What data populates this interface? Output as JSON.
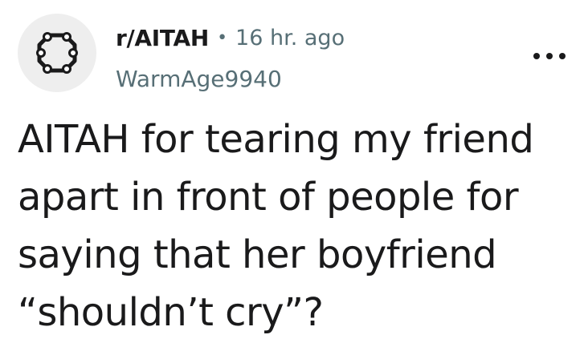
{
  "post": {
    "subreddit": "r/AITAH",
    "separator": "•",
    "time_ago": "16 hr. ago",
    "author": "WarmAge9940",
    "avatar_icon": "subreddit-avatar-icon",
    "more_icon": "more-options-icon",
    "title": "AITAH for tearing my friend apart in front of people for saying that her boyfriend “shouldn’t cry”?"
  },
  "colors": {
    "text": "#1a1a1b",
    "meta": "#576f76",
    "avatar_bg": "#eeeeee"
  }
}
